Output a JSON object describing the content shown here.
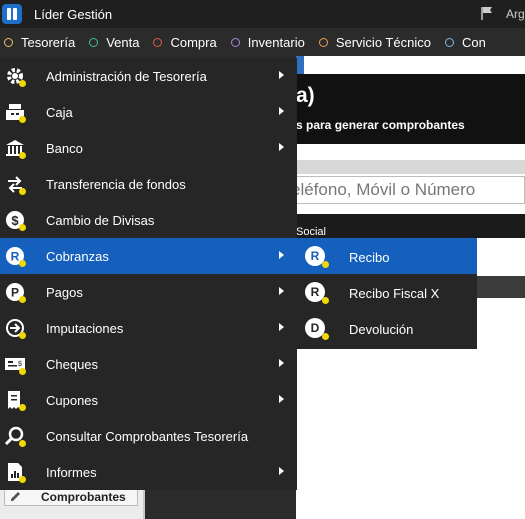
{
  "app": {
    "title": "Líder Gestión",
    "title_right": "Arg"
  },
  "topnav": [
    {
      "label": "Tesorería",
      "color": "#e8c060"
    },
    {
      "label": "Venta",
      "color": "#3fbf8a"
    },
    {
      "label": "Compra",
      "color": "#e05a4a"
    },
    {
      "label": "Inventario",
      "color": "#a58ad8"
    },
    {
      "label": "Servicio Técnico",
      "color": "#e8a050"
    },
    {
      "label": "Con",
      "color": "#7ab8e8"
    }
  ],
  "background": {
    "heading": "a)",
    "subheading": "s para generar comprobantes",
    "search_placeholder": "eléfono, Móvil o Número",
    "tab_text": "Social",
    "comprobantes_button": "Comprobantes"
  },
  "menu": [
    {
      "label": "Administración de Tesorería",
      "icon": "gear-icon",
      "arrow": true
    },
    {
      "label": "Caja",
      "icon": "cash-register-icon",
      "arrow": true
    },
    {
      "label": "Banco",
      "icon": "bank-icon",
      "arrow": true
    },
    {
      "label": "Transferencia de fondos",
      "icon": "transfer-arrows-icon",
      "arrow": false
    },
    {
      "label": "Cambio de Divisas",
      "icon": "dollar-coin-icon",
      "arrow": false
    },
    {
      "label": "Cobranzas",
      "icon": "r-circle-icon",
      "arrow": true,
      "active": true
    },
    {
      "label": "Pagos",
      "icon": "p-circle-icon",
      "arrow": true
    },
    {
      "label": "Imputaciones",
      "icon": "arrow-circle-icon",
      "arrow": true
    },
    {
      "label": "Cheques",
      "icon": "cheque-icon",
      "arrow": true
    },
    {
      "label": "Cupones",
      "icon": "receipt-icon",
      "arrow": true
    },
    {
      "label": "Consultar Comprobantes Tesorería",
      "icon": "magnifier-icon",
      "arrow": false
    },
    {
      "label": "Informes",
      "icon": "report-chart-icon",
      "arrow": true
    }
  ],
  "submenu": [
    {
      "label": "Recibo",
      "letter": "R",
      "icon": "r-circle-icon",
      "active": true
    },
    {
      "label": "Recibo Fiscal X",
      "letter": "R",
      "icon": "r-circle-icon"
    },
    {
      "label": "Devolución",
      "letter": "D",
      "icon": "d-circle-icon"
    }
  ]
}
